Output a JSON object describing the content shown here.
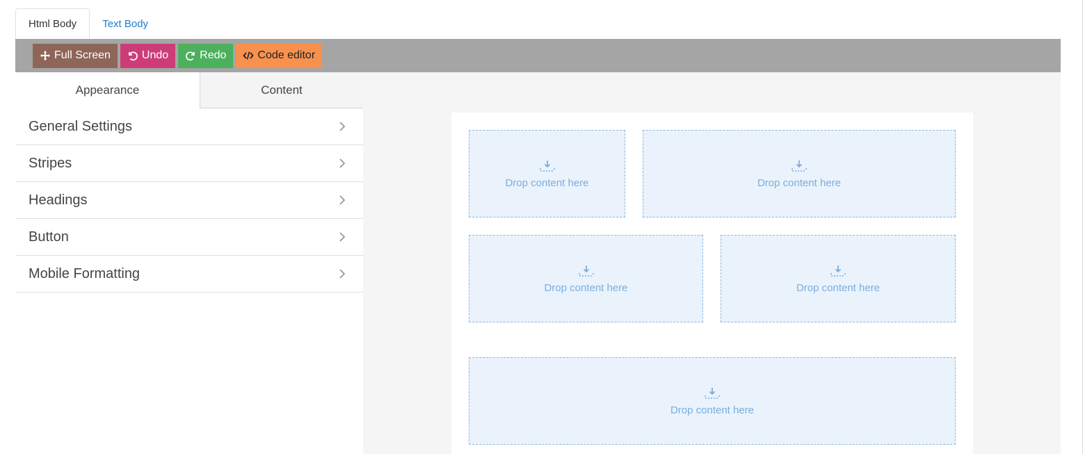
{
  "top_tabs": [
    {
      "label": "Html Body",
      "active": true
    },
    {
      "label": "Text Body",
      "active": false
    }
  ],
  "toolbar": {
    "fullscreen_label": "Full Screen",
    "undo_label": "Undo",
    "redo_label": "Redo",
    "code_editor_label": "Code editor"
  },
  "panel_tabs": {
    "appearance": "Appearance",
    "content": "Content"
  },
  "settings": [
    {
      "label": "General Settings"
    },
    {
      "label": "Stripes"
    },
    {
      "label": "Headings"
    },
    {
      "label": "Button"
    },
    {
      "label": "Mobile Formatting"
    }
  ],
  "drop_zones": [
    {
      "label": "Drop content here"
    },
    {
      "label": "Drop content here"
    },
    {
      "label": "Drop content here"
    },
    {
      "label": "Drop content here"
    },
    {
      "label": "Drop content here"
    }
  ],
  "colors": {
    "toolbar_bg": "#a5a5a5",
    "fullscreen_btn": "#8d6658",
    "undo_btn": "#cc3d78",
    "redo_btn": "#4cb05d",
    "code_btn": "#f8914e",
    "link_blue": "#1a7fd0",
    "drop_zone_bg": "#eaf2fc",
    "drop_zone_border": "#8bb9e0"
  },
  "icons": {
    "fullscreen": "move-arrows-icon",
    "undo": "undo-icon",
    "redo": "redo-icon",
    "code": "code-icon",
    "chevron": "chevron-right-icon",
    "drop": "download-tray-icon"
  }
}
